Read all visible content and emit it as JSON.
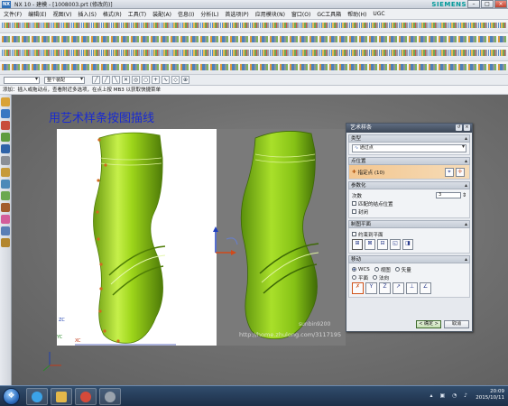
{
  "window": {
    "app_logo": "NX",
    "title": "NX 10 - 建模 - [1008003.prt  (修改的)]",
    "brand": "SIEMENS",
    "controls": [
      "–",
      "□",
      "×"
    ]
  },
  "menubar": [
    "文件(F)",
    "编辑(E)",
    "视图(V)",
    "插入(S)",
    "格式(R)",
    "工具(T)",
    "装配(A)",
    "信息(I)",
    "分析(L)",
    "首选项(P)",
    "应用模块(N)",
    "窗口(O)",
    "GC工具箱",
    "帮助(H)",
    "UGC"
  ],
  "selection_bar": {
    "filter": "",
    "scope": "整个装配"
  },
  "status_text": "添加：插入或拖动点，查看附近多选项，在点上按 MB3 以获取快捷菜单",
  "overlay": {
    "title": "用艺术样条按图描线",
    "watermark_top": "sunbin9200",
    "watermark_bottom": "http://home.zhulong.com/3117195"
  },
  "axes": {
    "zc": "ZC",
    "yc": "YC",
    "xc": "XC"
  },
  "dialog": {
    "title": "艺术样条",
    "sections": {
      "type": {
        "label": "类型",
        "value": "通过点"
      },
      "points": {
        "label": "点位置",
        "value": "指定点 (10)"
      },
      "param": {
        "label": "参数化",
        "degree_label": "次数",
        "degree_value": "3",
        "matching_label": "匹配的结点位置",
        "closed_label": "封闭"
      },
      "plane": {
        "label": "制图平面",
        "constrain_label": "约束到平面"
      },
      "move": {
        "label": "移动",
        "wcs": "WCS",
        "view": "视图",
        "vector": "矢量",
        "plane": "平面",
        "normal": "法向"
      }
    },
    "ok": "< 确定 >",
    "cancel": "取消"
  },
  "taskbar": {
    "time": "20:09",
    "date": "2015/10/11"
  }
}
